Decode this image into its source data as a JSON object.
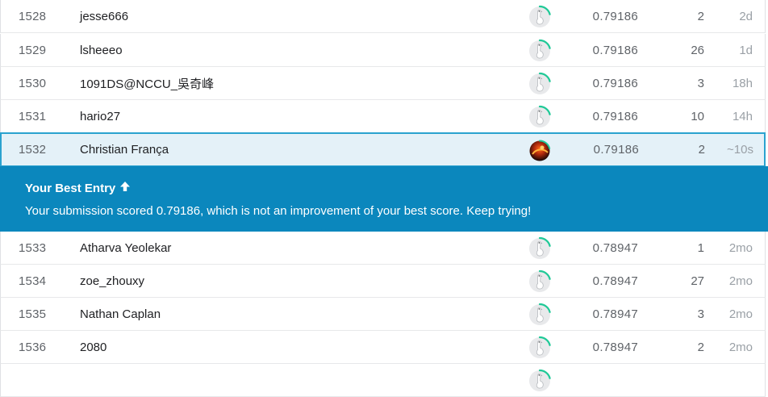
{
  "rows_top": [
    {
      "rank": "1528",
      "team": "jesse666",
      "score": "0.79186",
      "entries": "2",
      "last": "2d"
    },
    {
      "rank": "1529",
      "team": "lsheeeo",
      "score": "0.79186",
      "entries": "26",
      "last": "1d"
    },
    {
      "rank": "1530",
      "team": "1091DS@NCCU_吳奇峰",
      "score": "0.79186",
      "entries": "3",
      "last": "18h"
    },
    {
      "rank": "1531",
      "team": "hario27",
      "score": "0.79186",
      "entries": "10",
      "last": "14h"
    }
  ],
  "current_row": {
    "rank": "1532",
    "team": "Christian França",
    "score": "0.79186",
    "entries": "2",
    "last": "~10s"
  },
  "banner": {
    "title": "Your Best Entry",
    "message": "Your submission scored 0.79186, which is not an improvement of your best score. Keep trying!"
  },
  "rows_bottom": [
    {
      "rank": "1533",
      "team": "Atharva Yeolekar",
      "score": "0.78947",
      "entries": "1",
      "last": "2mo"
    },
    {
      "rank": "1534",
      "team": "zoe_zhouxy",
      "score": "0.78947",
      "entries": "27",
      "last": "2mo"
    },
    {
      "rank": "1535",
      "team": "Nathan Caplan",
      "score": "0.78947",
      "entries": "3",
      "last": "2mo"
    },
    {
      "rank": "1536",
      "team": "2080",
      "score": "0.78947",
      "entries": "2",
      "last": "2mo"
    },
    {
      "rank": "",
      "team": "",
      "score": "",
      "entries": "",
      "last": ""
    }
  ],
  "colors": {
    "banner_bg": "#0b87bd",
    "current_row_bg": "#e4f1f8",
    "current_row_border": "#2aa2cf",
    "progress_ring": "#20c997"
  },
  "icons": {
    "avatar_default": "default-goose-avatar-icon",
    "avatar_user": "user-photo-avatar",
    "banner_arrow": "arrow-up-icon"
  }
}
